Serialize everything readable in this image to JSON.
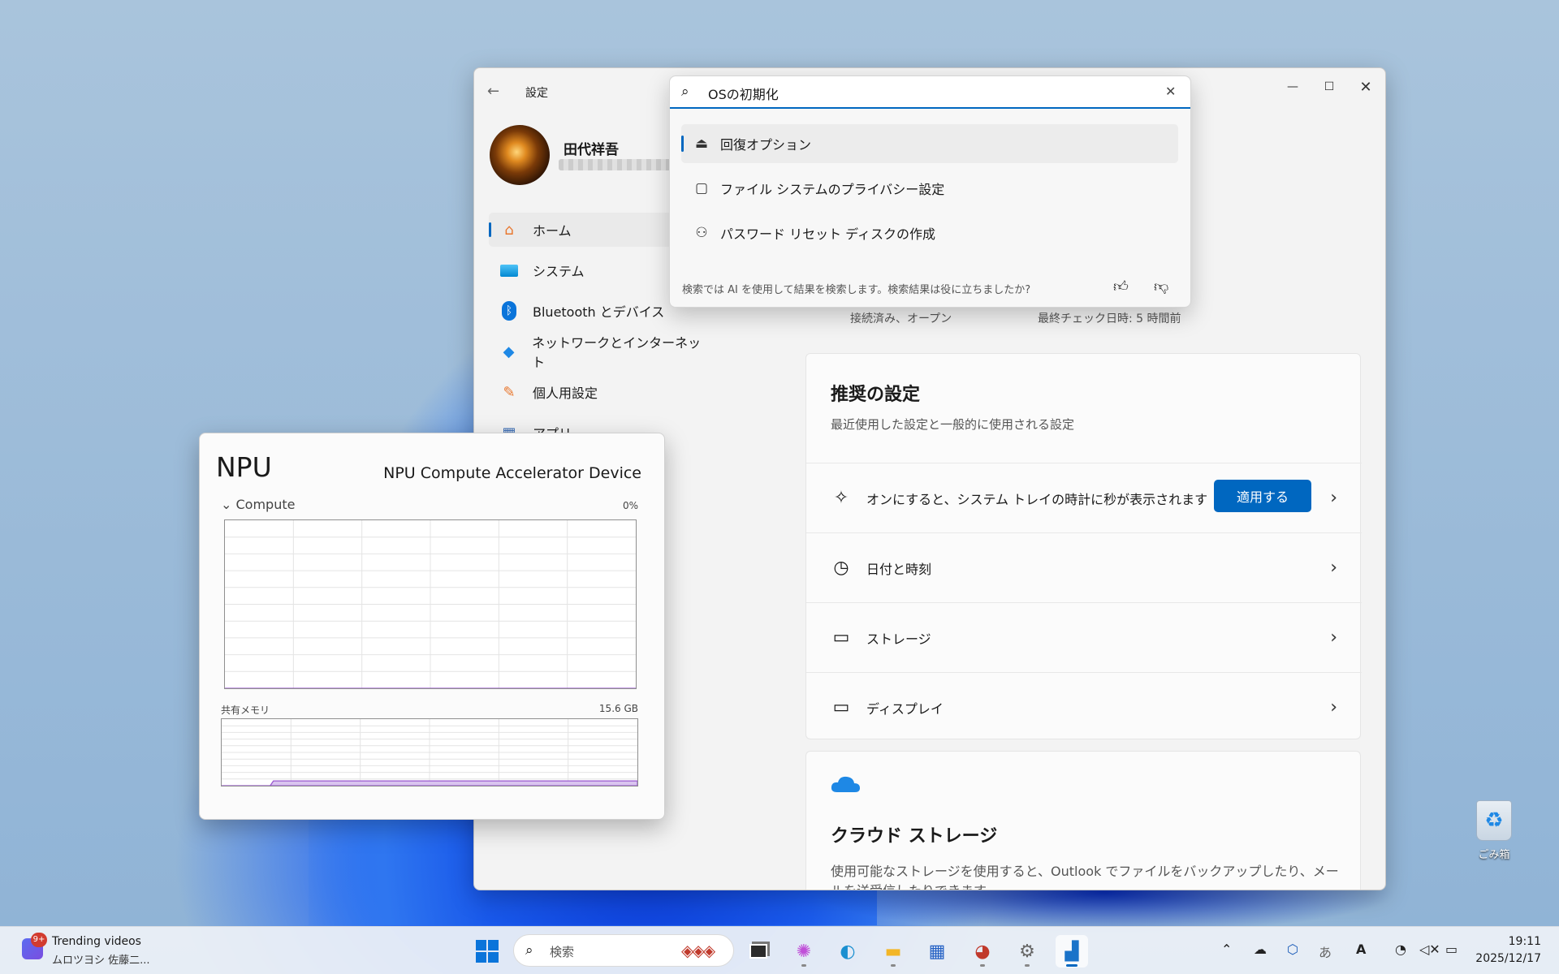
{
  "settings": {
    "app_title": "設定",
    "user_name": "田代祥吾",
    "nav": [
      {
        "label": "ホーム"
      },
      {
        "label": "システム"
      },
      {
        "label": "Bluetooth とデバイス"
      },
      {
        "label": "ネットワークとインターネット"
      },
      {
        "label": "個人用設定"
      },
      {
        "label": "アプリ"
      }
    ],
    "status_network": "接続済み、オープン",
    "status_update": "最終チェック日時: 5 時間前",
    "recommended": {
      "title": "推奨の設定",
      "subtitle": "最近使用した設定と一般的に使用される設定",
      "rows": [
        {
          "label": "オンにすると、システム トレイの時計に秒が表示されます",
          "button": "適用する"
        },
        {
          "label": "日付と時刻"
        },
        {
          "label": "ストレージ"
        },
        {
          "label": "ディスプレイ"
        }
      ]
    },
    "cloud": {
      "title": "クラウド ストレージ",
      "desc": "使用可能なストレージを使用すると、Outlook でファイルをバックアップしたり、メールを送受信したりできます。"
    }
  },
  "search": {
    "query": "OSの初期化",
    "results": [
      {
        "label": "回復オプション",
        "icon": "recovery-icon"
      },
      {
        "label": "ファイル システムのプライバシー設定",
        "icon": "folder-icon"
      },
      {
        "label": "パスワード リセット ディスクの作成",
        "icon": "users-icon"
      }
    ],
    "feedback": "検索では AI を使用して結果を検索します。検索結果は役に立ちましたか?"
  },
  "taskmanager": {
    "title": "NPU",
    "device": "NPU Compute Accelerator Device",
    "compute_label": "Compute",
    "compute_pct": "0%",
    "shared_label": "共有メモリ",
    "shared_value": "15.6 GB"
  },
  "chart_data": [
    {
      "type": "area",
      "title": "Compute",
      "y_unit": "%",
      "ylim": [
        0,
        100
      ],
      "x": [
        0,
        3,
        6,
        9,
        12,
        15,
        18,
        21,
        24,
        27,
        30,
        33,
        36,
        39,
        42,
        45,
        48,
        51,
        54,
        57,
        60
      ],
      "values": [
        0,
        0,
        0,
        0,
        0,
        0,
        0,
        0,
        0,
        0,
        0,
        0,
        0,
        0,
        0,
        0,
        0,
        0,
        0,
        0,
        0
      ],
      "grid": true
    },
    {
      "type": "area",
      "title": "共有メモリ",
      "total": "15.6 GB",
      "grid": true
    }
  ],
  "desktop": {
    "recycle_bin": "ごみ箱"
  },
  "taskbar": {
    "widget_badge": "9+",
    "widget_title": "Trending videos",
    "widget_sub": "ムロツヨシ 佐藤二...",
    "search_placeholder": "検索",
    "time": "19:11",
    "date": "2025/12/17"
  }
}
